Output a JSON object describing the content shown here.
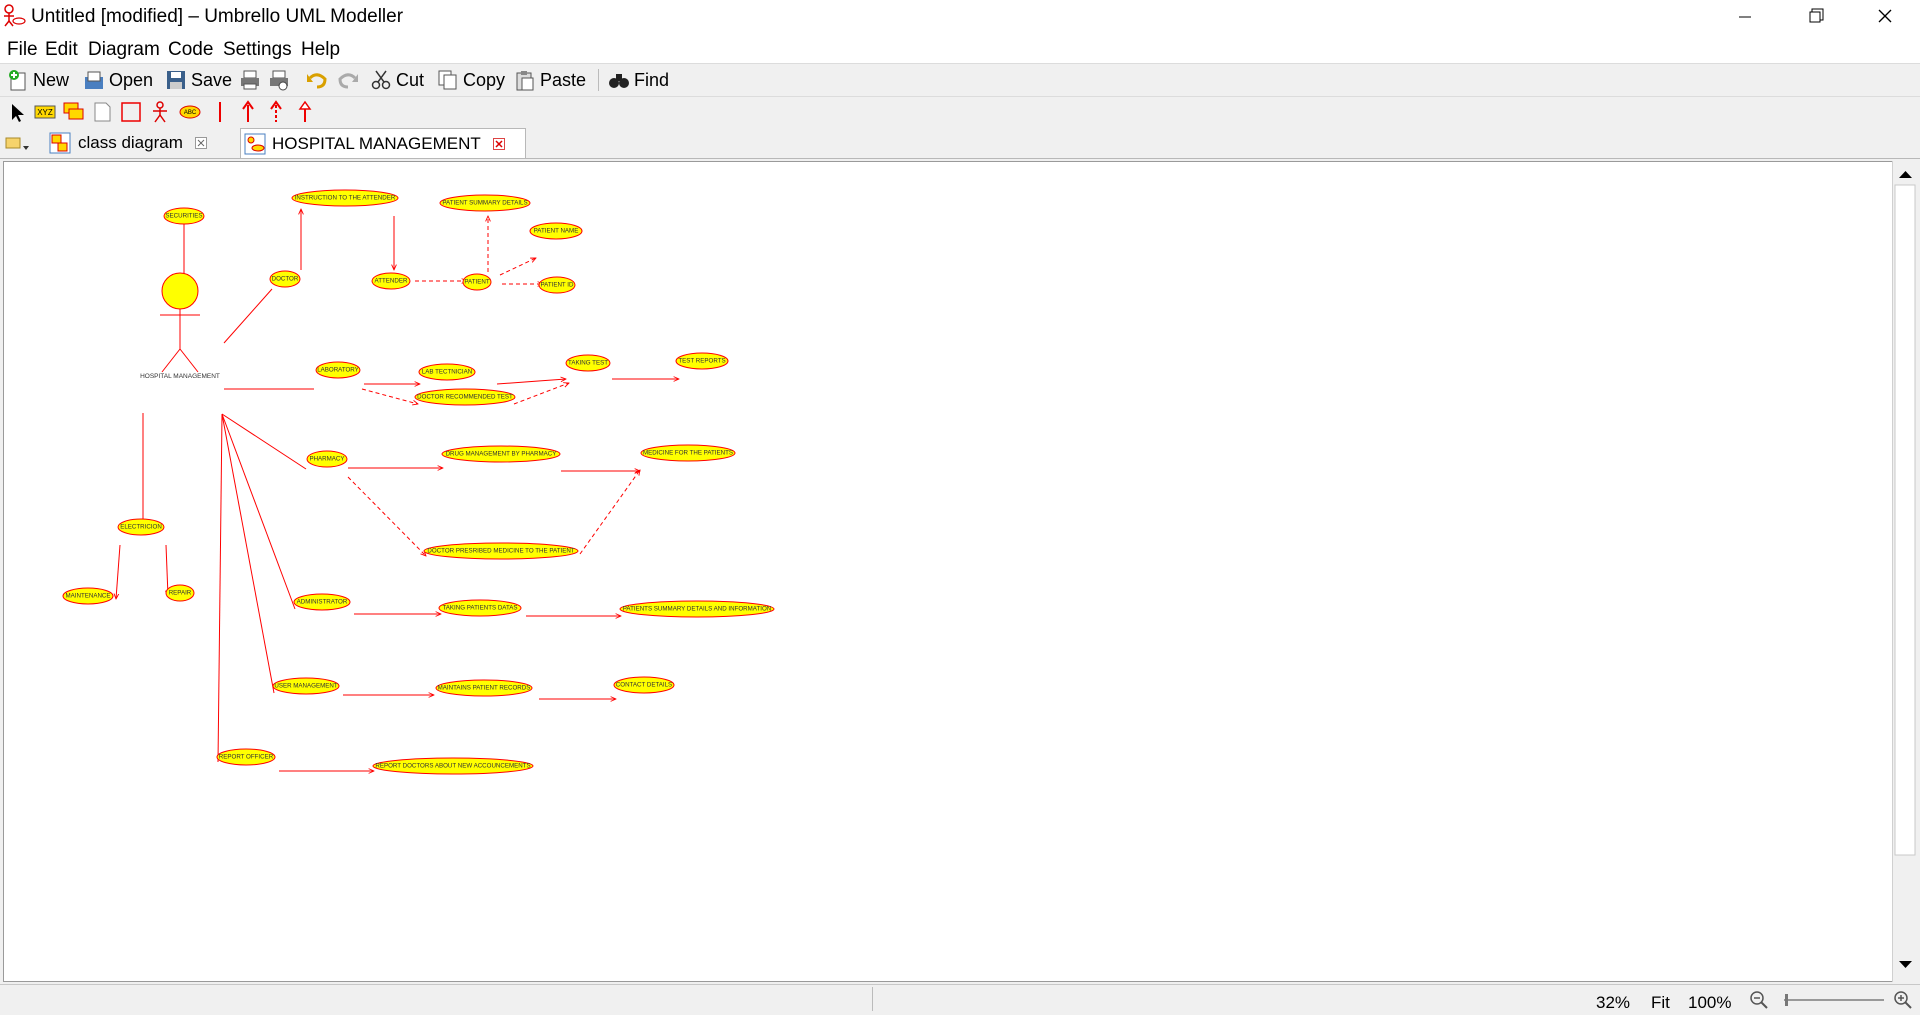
{
  "window": {
    "title": "Untitled [modified] – Umbrello UML Modeller"
  },
  "menu": [
    "File",
    "Edit",
    "Diagram",
    "Code",
    "Settings",
    "Help"
  ],
  "toolbar": {
    "new_label": "New",
    "open_label": "Open",
    "save_label": "Save",
    "cut_label": "Cut",
    "copy_label": "Copy",
    "paste_label": "Paste",
    "find_label": "Find"
  },
  "tabs": [
    {
      "label": "class diagram",
      "active": false
    },
    {
      "label": "HOSPITAL MANAGEMENT",
      "active": true
    }
  ],
  "diagram": {
    "actor_label": "HOSPITAL MANAGEMENT",
    "usecases": [
      "INSTRUCTION TO THE ATTENDER",
      "PATIENT SUMMARY DETAILS",
      "PATIENT NAME",
      "SECURITIES",
      "DOCTOR",
      "ATTENDER",
      "PATIENT",
      "PATIENT ID",
      "LABORATORY",
      "LAB TECTNICIAN",
      "TAKING TEST",
      "TEST REPORTS",
      "DOCTOR RECOMMENDED TEST",
      "PHARMACY",
      "DRUG MANAGEMENT BY PHARMACY",
      "MEDICINE FOR THE PATIENTS",
      "DOCTOR PRESRIBED MEDICINE TO THE PATIENT",
      "ELECTRICION",
      "MAINTENANCE",
      "REPAIR",
      "ADMINISTRATOR",
      "TAKING PATIENTS DATAS",
      "PATIENTS SUMMARY DETAILS AND INFORMATION",
      "USER MANAGEMENT",
      "MAINTAINS PATIENT RECORDS",
      "CONTACT DETAILS",
      "REPORT OFFICER",
      "REPORT DOCTORS ABOUT NEW ACCOUNCEMENTS"
    ],
    "colors": {
      "usecase_fill": "#ffff00",
      "line": "#ff0000"
    }
  },
  "status": {
    "zoom": "32%",
    "fit": "Fit",
    "full": "100%"
  }
}
